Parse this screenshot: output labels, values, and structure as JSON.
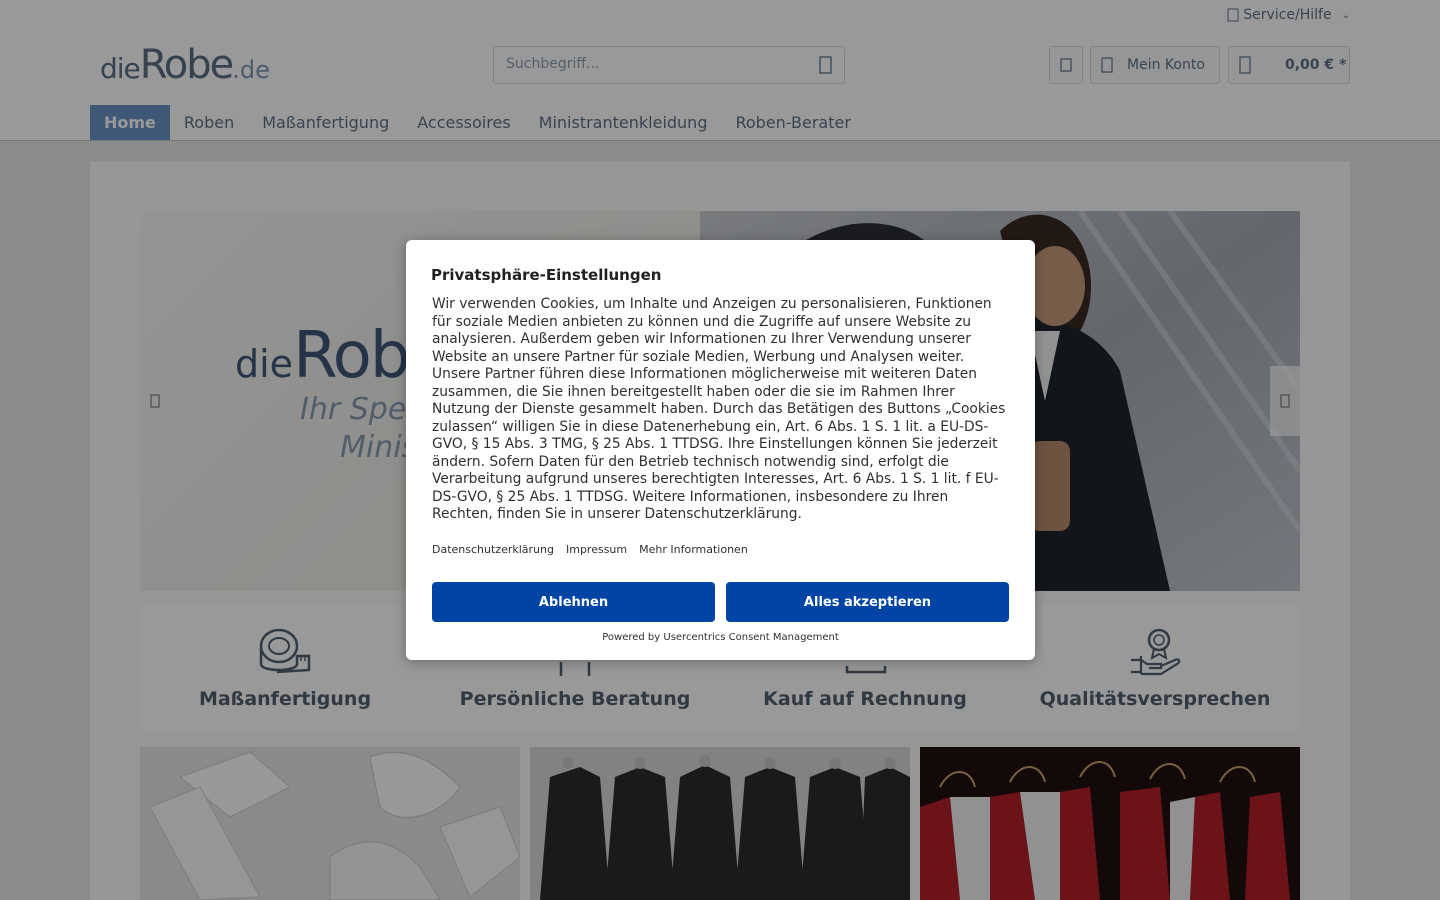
{
  "header": {
    "service_label": "Service/Hilfe",
    "logo": {
      "die": "die",
      "robe": "Robe",
      "de": ".de"
    },
    "search_placeholder": "Suchbegriff...",
    "account_label": "Mein Konto",
    "cart_amount": "0,00 € *"
  },
  "nav": {
    "items": [
      {
        "label": "Home",
        "active": true
      },
      {
        "label": "Roben"
      },
      {
        "label": "Maßanfertigung"
      },
      {
        "label": "Accessoires"
      },
      {
        "label": "Ministrantenkleidung"
      },
      {
        "label": "Roben-Berater"
      }
    ]
  },
  "slider": {
    "logo_die": "die",
    "logo_robe": "Rob",
    "sub_line1": "Ihr Spezi",
    "sub_line2": "Minis"
  },
  "features": [
    {
      "title": "Maßanfertigung",
      "icon": "measuring-tape-icon"
    },
    {
      "title": "Persönliche Beratung",
      "icon": "person-icon"
    },
    {
      "title": "Kauf auf Rechnung",
      "icon": "invoice-icon"
    },
    {
      "title": "Qualitätsversprechen",
      "icon": "quality-award-icon"
    }
  ],
  "consent": {
    "title": "Privatsphäre-Einstellungen",
    "text": "Wir verwenden Cookies, um Inhalte und Anzeigen zu personalisieren, Funktionen für soziale Medien anbieten zu können und die Zugriffe auf unsere Website zu analysieren. Außerdem geben wir Informationen zu Ihrer Verwendung unserer Website an unsere Partner für soziale Medien, Werbung und Analysen weiter. Unsere Partner führen diese Informationen möglicherweise mit weiteren Daten zusammen, die Sie ihnen bereitgestellt haben oder die sie im Rahmen Ihrer Nutzung der Dienste gesammelt haben. Durch das Betätigen des Buttons „Cookies zulassen“ willigen Sie in diese Datenerhebung ein, Art. 6 Abs. 1 S. 1 lit. a EU-DS-GVO, § 15 Abs. 3 TMG, § 25 Abs. 1 TTDSG. Ihre Einstellungen können Sie jederzeit ändern. Sofern Daten für den Betrieb technisch notwendig sind, erfolgt die Verarbeitung aufgrund unseres berechtigten Interesses, Art. 6 Abs. 1 S. 1 lit. f EU-DS-GVO, § 25 Abs. 1 TTDSG. Weitere Informationen, insbesondere zu Ihren Rechten, finden Sie in unserer Datenschutzerklärung.",
    "links": [
      "Datenschutzerklärung",
      "Impressum",
      "Mehr Informationen"
    ],
    "deny_label": "Ablehnen",
    "accept_label": "Alles akzeptieren",
    "powered_by": "Powered by Usercentrics Consent Management"
  },
  "colors": {
    "primary_button": "#0045a5",
    "nav_active": "#6c93c8",
    "text": "#5f7285"
  }
}
